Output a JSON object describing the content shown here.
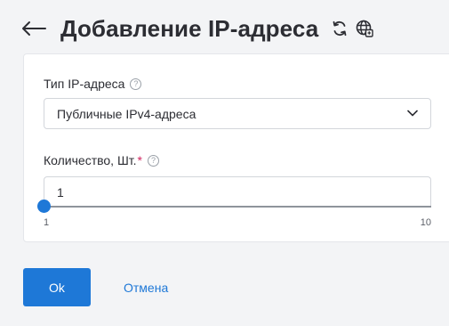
{
  "header": {
    "title": "Добавление IP-адреса",
    "icons": [
      "back-arrow-icon",
      "refresh-icon",
      "globe-icon"
    ]
  },
  "form": {
    "ip_type": {
      "label": "Тип IP-адреса",
      "selected": "Публичные IPv4-адреса"
    },
    "quantity": {
      "label": "Количество, Шт.",
      "required_mark": "*",
      "value": "1",
      "min": "1",
      "max": "10",
      "level": 0.0
    },
    "help_glyph": "?"
  },
  "actions": {
    "ok_label": "Ok",
    "cancel_label": "Отмена"
  },
  "colors": {
    "accent": "#1e78d7",
    "required": "#d0245e",
    "text": "#2c2d33",
    "background": "#f3f4f6"
  }
}
